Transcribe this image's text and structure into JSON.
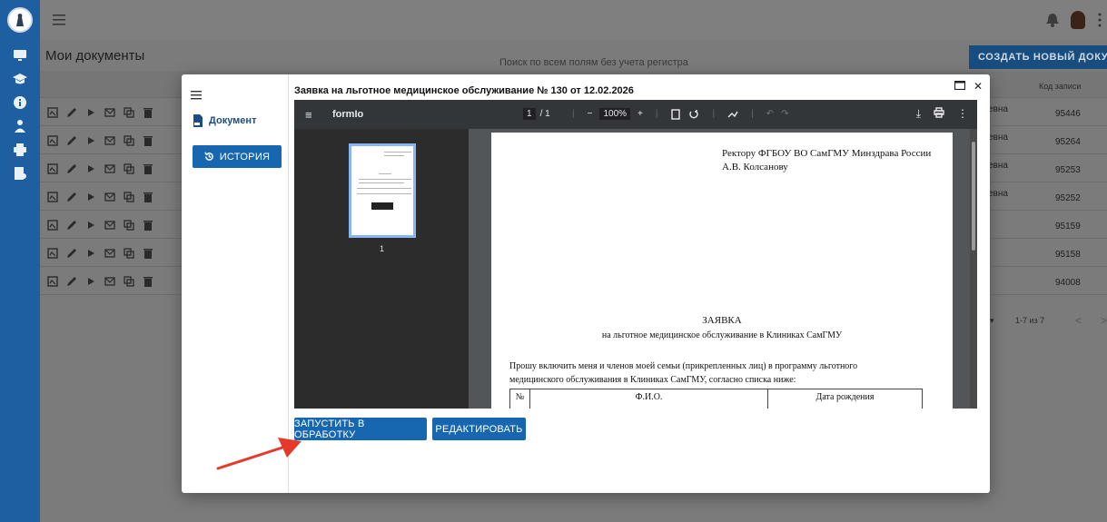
{
  "colors": {
    "rail": "#1d5fa0",
    "accent": "#1767b0",
    "overlay": "#7b7b7b",
    "arrow": "#e53a2a"
  },
  "rail": {
    "icons": [
      "monitor-icon",
      "graduation-cap-icon",
      "info-icon",
      "person-icon",
      "printer-icon",
      "user-doc-icon"
    ]
  },
  "page": {
    "title": "Мои документы",
    "search_placeholder": "Поиск по всем полям без учета регистра",
    "create_button": "СОЗДАТЬ НОВЫЙ ДОКУМЕНТ",
    "code_header": "Код записи",
    "rows": [
      {
        "name": "евна",
        "code": "95446"
      },
      {
        "name": "евна",
        "code": "95264"
      },
      {
        "name": "евна",
        "code": "95253"
      },
      {
        "name": "евна",
        "code": "95252"
      },
      {
        "name": "",
        "code": "95159"
      },
      {
        "name": "",
        "code": "95158"
      },
      {
        "name": "",
        "code": "94008"
      }
    ],
    "pager": {
      "range": "1-7 из 7",
      "prev": "<",
      "next": ">"
    }
  },
  "modal": {
    "title": "Заявка на льготное медицинское обслуживание № 130 от 12.02.2026",
    "side": {
      "document_link": "Документ",
      "history_button": "ИСТОРИЯ"
    },
    "viewer": {
      "file_name": "formIo",
      "page_current": "1",
      "page_total": "/ 1",
      "zoom": "100%",
      "thumb_page": "1"
    },
    "pdf": {
      "address_line1": "Ректору ФГБОУ ВО СамГМУ Минздрава России",
      "address_line2": "А.В. Колсанову",
      "heading": "ЗАЯВКА",
      "subheading": "на льготное медицинское обслуживание в Клиниках СамГМУ",
      "body_line1": "Прошу включить меня и членов моей семьи (прикрепленных лиц) в программу льготного",
      "body_line2": "медицинского обслуживания в Клиниках СамГМУ, согласно списка ниже:",
      "table_headers": [
        "№",
        "Ф.И.О.",
        "Дата рождения"
      ]
    },
    "buttons": {
      "process": "ЗАПУСТИТЬ В ОБРАБОТКУ",
      "edit": "РЕДАКТИРОВАТЬ"
    }
  }
}
